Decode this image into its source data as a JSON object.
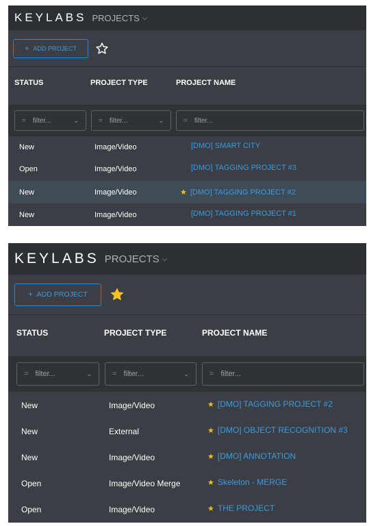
{
  "panel1": {
    "brand": "KEYLABS",
    "projects_menu": "PROJECTS",
    "add_project_label": "ADD PROJECT",
    "columns": {
      "status": "STATUS",
      "type": "PROJECT TYPE",
      "name": "PROJECT NAME"
    },
    "filter_placeholder": "filter...",
    "rows": [
      {
        "status": "New",
        "type": "Image/Video",
        "name": "[DMO] SMART CITY",
        "starred": false
      },
      {
        "status": "Open",
        "type": "Image/Video",
        "name": "[DMO] TAGGING PROJECT #3",
        "starred": false
      },
      {
        "status": "New",
        "type": "Image/Video",
        "name": "[DMO] TAGGING PROJECT #2",
        "starred": true
      },
      {
        "status": "New",
        "type": "Image/Video",
        "name": "[DMO] TAGGING PROJECT #1",
        "starred": false
      }
    ]
  },
  "panel2": {
    "brand": "KEYLABS",
    "projects_menu": "PROJECTS",
    "add_project_label": "ADD PROJECT",
    "columns": {
      "status": "STATUS",
      "type": "PROJECT TYPE",
      "name": "PROJECT NAME"
    },
    "filter_placeholder": "filter...",
    "rows": [
      {
        "status": "New",
        "type": "Image/Video",
        "name": "[DMO] TAGGING PROJECT #2",
        "starred": true
      },
      {
        "status": "New",
        "type": "External",
        "name": "[DMO] OBJECT RECOGNITION #3",
        "starred": true
      },
      {
        "status": "New",
        "type": "Image/Video",
        "name": "[DMO] ANNOTATION",
        "starred": true
      },
      {
        "status": "Open",
        "type": "Image/Video Merge",
        "name": "Skeleton - MERGE",
        "starred": true
      },
      {
        "status": "Open",
        "type": "Image/Video",
        "name": "THE PROJECT",
        "starred": true
      }
    ]
  },
  "colors": {
    "accent": "#3b9be0",
    "star": "#f2c020",
    "topbar": "#2c3035",
    "panel": "#3b3f45"
  }
}
